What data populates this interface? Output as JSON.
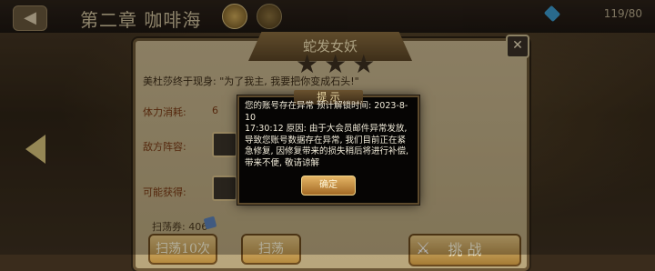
{
  "header": {
    "chapter_title": "第二章 咖啡海",
    "resource_count": "119/80"
  },
  "stage": {
    "name": "蛇发女妖",
    "stars": 3,
    "quote": "美杜莎终于现身: \"为了我主, 我要把你变成石头!\"",
    "stamina_label": "体力消耗:",
    "stamina_value": "6",
    "enemy_label": "敌方阵容:",
    "rewards_label": "可能获得:",
    "sweep_tickets": "扫荡券: 406",
    "buttons": {
      "sweep10": "扫荡10次",
      "sweep": "扫荡",
      "challenge": "挑 战"
    }
  },
  "dialog": {
    "title": "提 示",
    "message": "您的账号存在异常 预计解锁时间: 2023-8-10\n17:30:12 原因: 由于大会员邮件异常发放, 导致您账号数据存在异常, 我们目前正在紧急修复, 因修复带来的损失稍后将进行补偿, 带来不便, 敬请谅解",
    "ok_label": "确定"
  },
  "icons": {
    "back": "back-arrow-icon",
    "close": "close-icon",
    "star": "star-icon",
    "challenge": "crossed-swords-icon",
    "ticket": "ticket-icon",
    "prev_stage": "left-arrow-icon"
  },
  "colors": {
    "accent": "#e4b565",
    "panel": "#c7b58e"
  }
}
